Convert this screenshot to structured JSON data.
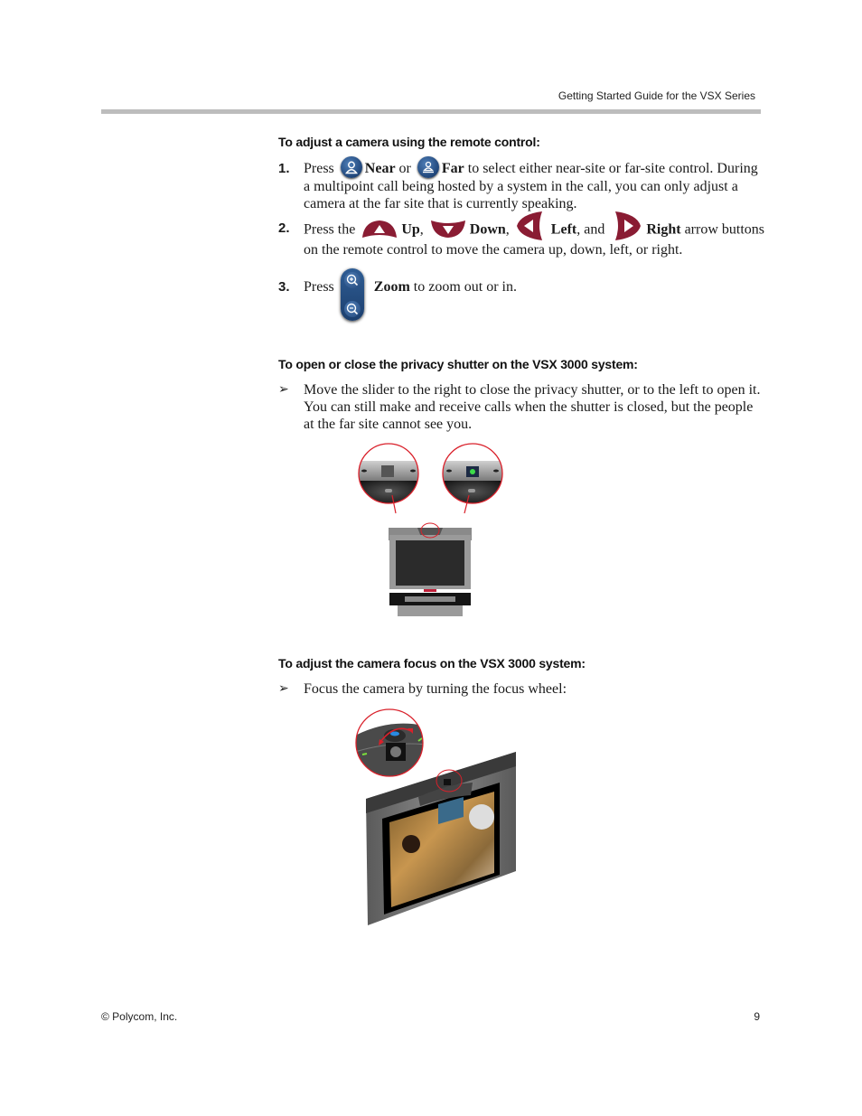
{
  "header": {
    "running_title": "Getting Started Guide for the VSX Series"
  },
  "section_remote": {
    "heading": "To adjust a camera using the remote control:",
    "steps": [
      {
        "number": "1.",
        "pre": "Press",
        "near_label": "Near",
        "or": "or",
        "far_label": "Far",
        "post": "to select either near-site or far-site control. During a multipoint call being hosted by a system in the call, you can only adjust a camera at the far site that is currently speaking."
      },
      {
        "number": "2.",
        "pre": "Press the",
        "up_label": "Up",
        "down_label": "Down",
        "left_label": "Left",
        "and": ", and",
        "right_label": "Right",
        "post": "arrow buttons on the remote control to move the camera up, down, left, or right."
      },
      {
        "number": "3.",
        "pre": "Press",
        "zoom_label": "Zoom",
        "post": "to zoom out or in."
      }
    ],
    "icons": {
      "near": "near-person-icon",
      "far": "far-person-icon",
      "up": "up-arrow-icon",
      "down": "down-arrow-icon",
      "left": "left-arrow-icon",
      "right": "right-arrow-icon",
      "zoom_in": "zoom-in-icon",
      "zoom_out": "zoom-out-icon"
    }
  },
  "section_shutter": {
    "heading": "To open or close the privacy shutter on the VSX 3000 system:",
    "bullet_glyph": "➢",
    "text": "Move the slider to the right to close the privacy shutter, or to the left to open it. You can still make and receive calls when the shutter is closed, but the people at the far site cannot see you."
  },
  "section_focus": {
    "heading": "To adjust the camera focus on the VSX 3000 system:",
    "bullet_glyph": "➢",
    "text": "Focus the camera by turning the focus wheel:"
  },
  "colors": {
    "remote_blue": "#24487a",
    "arrow_maroon": "#8a1c33",
    "callout_red": "#d9202a",
    "rule_gray": "#bdbdbd"
  },
  "footer": {
    "copyright": "© Polycom, Inc.",
    "page_number": "9"
  }
}
